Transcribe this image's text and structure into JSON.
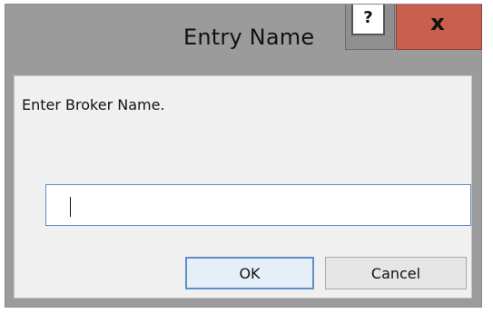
{
  "window": {
    "title": "Entry Name",
    "help_label": "?",
    "close_label": "x"
  },
  "dialog": {
    "prompt": "Enter Broker Name.",
    "input_value": "",
    "ok_label": "OK",
    "cancel_label": "Cancel"
  },
  "colors": {
    "close_button": "#c9604d",
    "focus_border": "#5e8ec7"
  }
}
